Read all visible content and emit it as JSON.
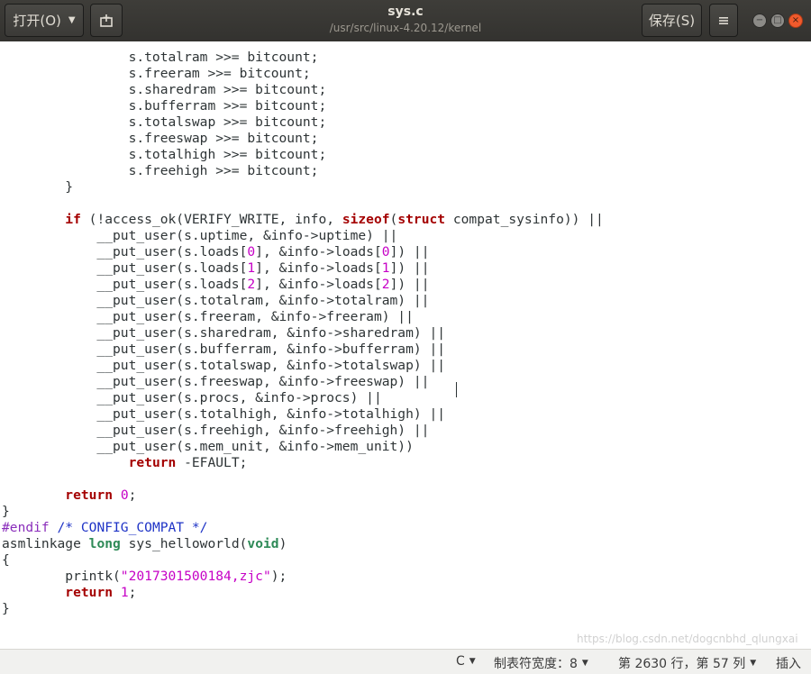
{
  "header": {
    "open_label": "打开(O)",
    "title": "sys.c",
    "subtitle": "/usr/src/linux-4.20.12/kernel",
    "save_label": "保存(S)",
    "pin_icon": "new-document-icon",
    "menu_icon": "hamburger-menu-icon"
  },
  "window_controls": {
    "minimize": "−",
    "maximize": "□",
    "close": "×"
  },
  "code_lines": [
    [
      [
        "p",
        "\t\ts.totalram >>= bitcount;"
      ]
    ],
    [
      [
        "p",
        "\t\ts.freeram >>= bitcount;"
      ]
    ],
    [
      [
        "p",
        "\t\ts.sharedram >>= bitcount;"
      ]
    ],
    [
      [
        "p",
        "\t\ts.bufferram >>= bitcount;"
      ]
    ],
    [
      [
        "p",
        "\t\ts.totalswap >>= bitcount;"
      ]
    ],
    [
      [
        "p",
        "\t\ts.freeswap >>= bitcount;"
      ]
    ],
    [
      [
        "p",
        "\t\ts.totalhigh >>= bitcount;"
      ]
    ],
    [
      [
        "p",
        "\t\ts.freehigh >>= bitcount;"
      ]
    ],
    [
      [
        "p",
        "\t}"
      ]
    ],
    [
      [
        "p",
        ""
      ]
    ],
    [
      [
        "p",
        "\t"
      ],
      [
        "kw",
        "if"
      ],
      [
        "p",
        " (!access_ok(VERIFY_WRITE, info, "
      ],
      [
        "kw",
        "sizeof"
      ],
      [
        "p",
        "("
      ],
      [
        "kw",
        "struct"
      ],
      [
        "p",
        " compat_sysinfo)) ||"
      ]
    ],
    [
      [
        "p",
        "\t    __put_user(s.uptime, &info->uptime) ||"
      ]
    ],
    [
      [
        "p",
        "\t    __put_user(s.loads["
      ],
      [
        "num",
        "0"
      ],
      [
        "p",
        "], &info->loads["
      ],
      [
        "num",
        "0"
      ],
      [
        "p",
        "]) ||"
      ]
    ],
    [
      [
        "p",
        "\t    __put_user(s.loads["
      ],
      [
        "num",
        "1"
      ],
      [
        "p",
        "], &info->loads["
      ],
      [
        "num",
        "1"
      ],
      [
        "p",
        "]) ||"
      ]
    ],
    [
      [
        "p",
        "\t    __put_user(s.loads["
      ],
      [
        "num",
        "2"
      ],
      [
        "p",
        "], &info->loads["
      ],
      [
        "num",
        "2"
      ],
      [
        "p",
        "]) ||"
      ]
    ],
    [
      [
        "p",
        "\t    __put_user(s.totalram, &info->totalram) ||"
      ]
    ],
    [
      [
        "p",
        "\t    __put_user(s.freeram, &info->freeram) ||"
      ]
    ],
    [
      [
        "p",
        "\t    __put_user(s.sharedram, &info->sharedram) ||"
      ]
    ],
    [
      [
        "p",
        "\t    __put_user(s.bufferram, &info->bufferram) ||"
      ]
    ],
    [
      [
        "p",
        "\t    __put_user(s.totalswap, &info->totalswap) ||"
      ]
    ],
    [
      [
        "p",
        "\t    __put_user(s.freeswap, &info->freeswap) ||"
      ]
    ],
    [
      [
        "p",
        "\t    __put_user(s.procs, &info->procs) ||"
      ]
    ],
    [
      [
        "p",
        "\t    __put_user(s.totalhigh, &info->totalhigh) ||"
      ]
    ],
    [
      [
        "p",
        "\t    __put_user(s.freehigh, &info->freehigh) ||"
      ]
    ],
    [
      [
        "p",
        "\t    __put_user(s.mem_unit, &info->mem_unit))"
      ]
    ],
    [
      [
        "p",
        "\t\t"
      ],
      [
        "kw",
        "return"
      ],
      [
        "p",
        " -EFAULT;"
      ]
    ],
    [
      [
        "p",
        ""
      ]
    ],
    [
      [
        "p",
        "\t"
      ],
      [
        "kw",
        "return"
      ],
      [
        "p",
        " "
      ],
      [
        "num",
        "0"
      ],
      [
        "p",
        ";"
      ]
    ],
    [
      [
        "p",
        "}"
      ]
    ],
    [
      [
        "pp",
        "#endif"
      ],
      [
        "p",
        " "
      ],
      [
        "cm",
        "/* CONFIG_COMPAT */"
      ]
    ],
    [
      [
        "p",
        "asmlinkage "
      ],
      [
        "ty",
        "long"
      ],
      [
        "p",
        " sys_helloworld("
      ],
      [
        "ty",
        "void"
      ],
      [
        "p",
        ")"
      ]
    ],
    [
      [
        "p",
        "{"
      ]
    ],
    [
      [
        "p",
        "\tprintk("
      ],
      [
        "str",
        "\"2017301500184,zjc\""
      ],
      [
        "p",
        ");"
      ]
    ],
    [
      [
        "p",
        "\t"
      ],
      [
        "kw",
        "return"
      ],
      [
        "p",
        " "
      ],
      [
        "num",
        "1"
      ],
      [
        "p",
        ";"
      ]
    ],
    [
      [
        "p",
        "}"
      ]
    ]
  ],
  "statusbar": {
    "language": "C",
    "tab_width": "制表符宽度：8",
    "position": "第 2630 行，第 57 列",
    "insert_mode": "插入",
    "watermark": "https://blog.csdn.net/dogcnbhd_qlungxai"
  },
  "colors": {
    "keyword": "#a40000",
    "type": "#2e8a57",
    "number": "#c600c6",
    "preprocessor": "#8a2dbb",
    "comment": "#1e33c6"
  }
}
